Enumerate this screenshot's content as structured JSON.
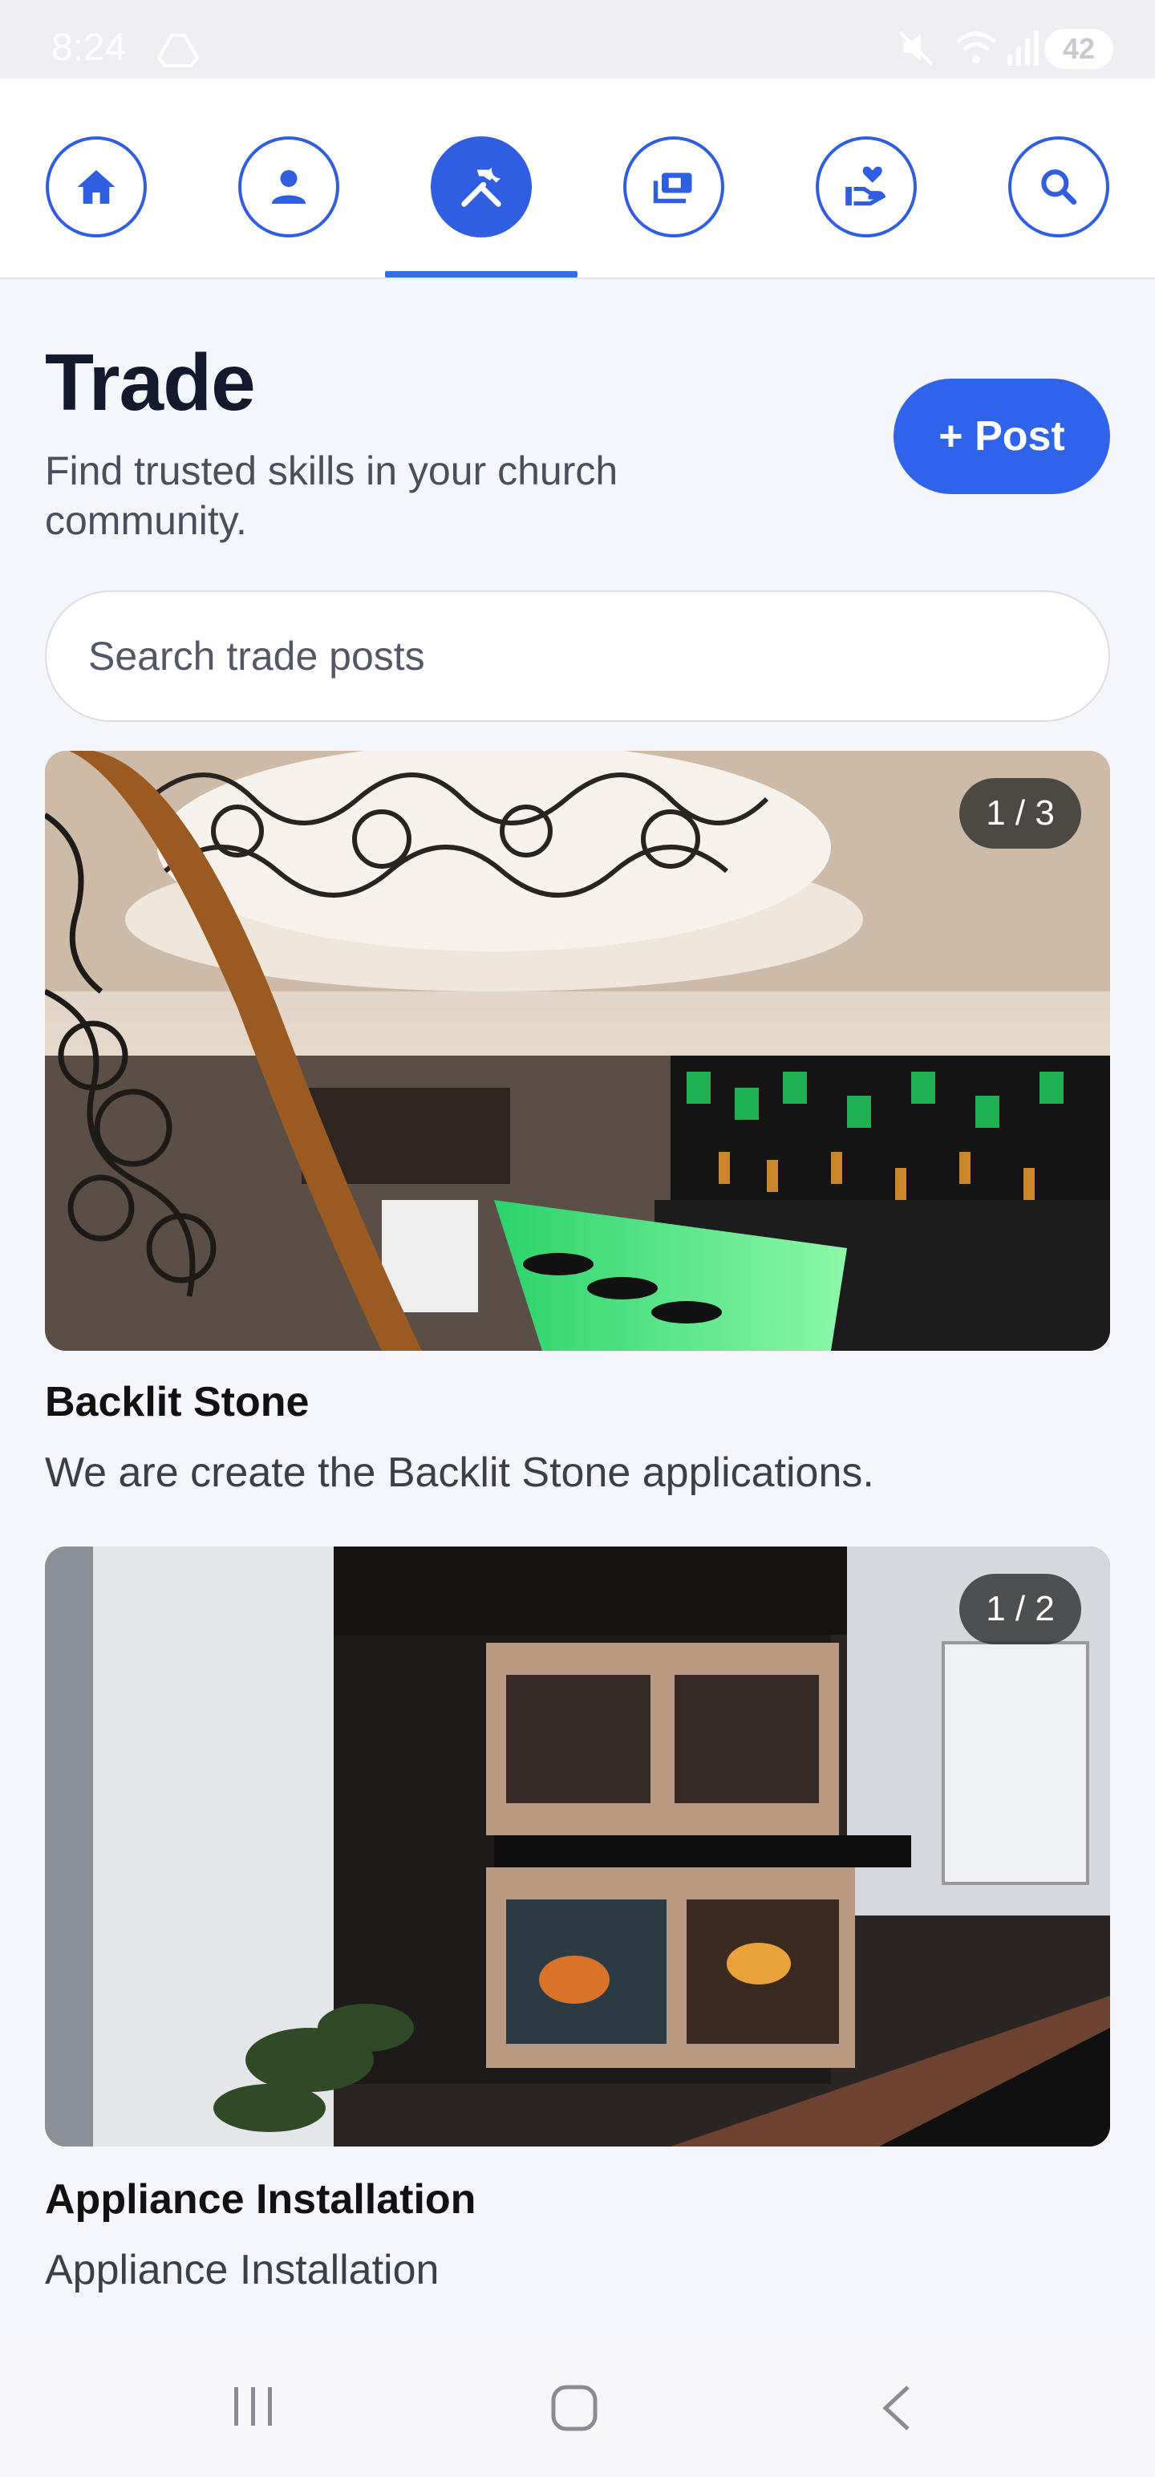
{
  "status_bar": {
    "time": "8:24",
    "battery": "42"
  },
  "nav": {
    "items": [
      {
        "name": "home",
        "icon": "home-icon"
      },
      {
        "name": "profile",
        "icon": "person-icon"
      },
      {
        "name": "trade",
        "icon": "tools-icon",
        "active": true
      },
      {
        "name": "media",
        "icon": "money-icon"
      },
      {
        "name": "giving",
        "icon": "heart-hand-icon"
      },
      {
        "name": "search",
        "icon": "search-icon"
      }
    ]
  },
  "header": {
    "title": "Trade",
    "subtitle": "Find trusted skills in your church community.",
    "post_button": "+ Post"
  },
  "search": {
    "placeholder": "Search trade posts"
  },
  "posts": [
    {
      "title": "Backlit Stone",
      "description": "We are create the Backlit Stone applications.",
      "counter": "1 / 3"
    },
    {
      "title": "Appliance Installation",
      "description": "Appliance Installation",
      "counter": "1 / 2"
    }
  ],
  "colors": {
    "accent": "#2f63ea",
    "background": "#f5f6fb"
  }
}
